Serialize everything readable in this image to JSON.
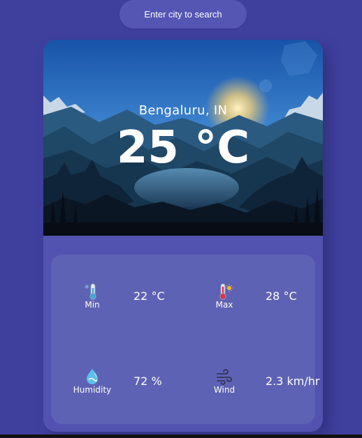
{
  "search": {
    "placeholder": "Enter city to search"
  },
  "weather": {
    "location": "Bengaluru, IN",
    "temperature": "25 °C"
  },
  "details": {
    "min": {
      "label": "Min",
      "value": "22 °C",
      "icon": "thermometer-cold-icon"
    },
    "max": {
      "label": "Max",
      "value": "28 °C",
      "icon": "thermometer-hot-icon"
    },
    "humidity": {
      "label": "Humidity",
      "value": "72 %",
      "icon": "water-drop-icon"
    },
    "wind": {
      "label": "Wind",
      "value": "2.3 km/hr",
      "icon": "wind-icon"
    }
  },
  "colors": {
    "background": "#3f3f9e",
    "card": "#5252b0",
    "details_panel": "#5e62b4",
    "search_pill": "#5555b3"
  }
}
